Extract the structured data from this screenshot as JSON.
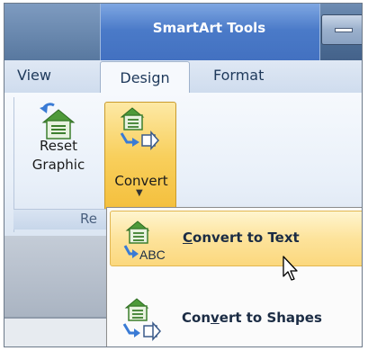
{
  "context_tab": {
    "title": "SmartArt Tools"
  },
  "tabs": [
    {
      "label": "View"
    },
    {
      "label": "Design"
    },
    {
      "label": "Format"
    }
  ],
  "ribbon": {
    "reset_button": {
      "line1": "Reset",
      "line2": "Graphic"
    },
    "convert_button": {
      "label": "Convert"
    },
    "group_label": "Re"
  },
  "menu": {
    "items": [
      {
        "pre": "",
        "accel": "C",
        "post": "onvert to Text",
        "icon": "convert-to-text-icon",
        "state": "hovered"
      },
      {
        "pre": "Con",
        "accel": "v",
        "post": "ert to Shapes",
        "icon": "convert-to-shapes-icon",
        "state": "normal"
      }
    ]
  },
  "icons": {
    "minimize": "minimize-icon",
    "reset_graphic": "reset-graphic-icon",
    "convert": "convert-icon",
    "cursor": "mouse-pointer-icon",
    "abc_label": "ABC"
  },
  "colors": {
    "context_tab": "#4a7ac8",
    "hover_fill": "#fde39b",
    "hover_border": "#e2b751",
    "tab_text": "#1e395b"
  }
}
